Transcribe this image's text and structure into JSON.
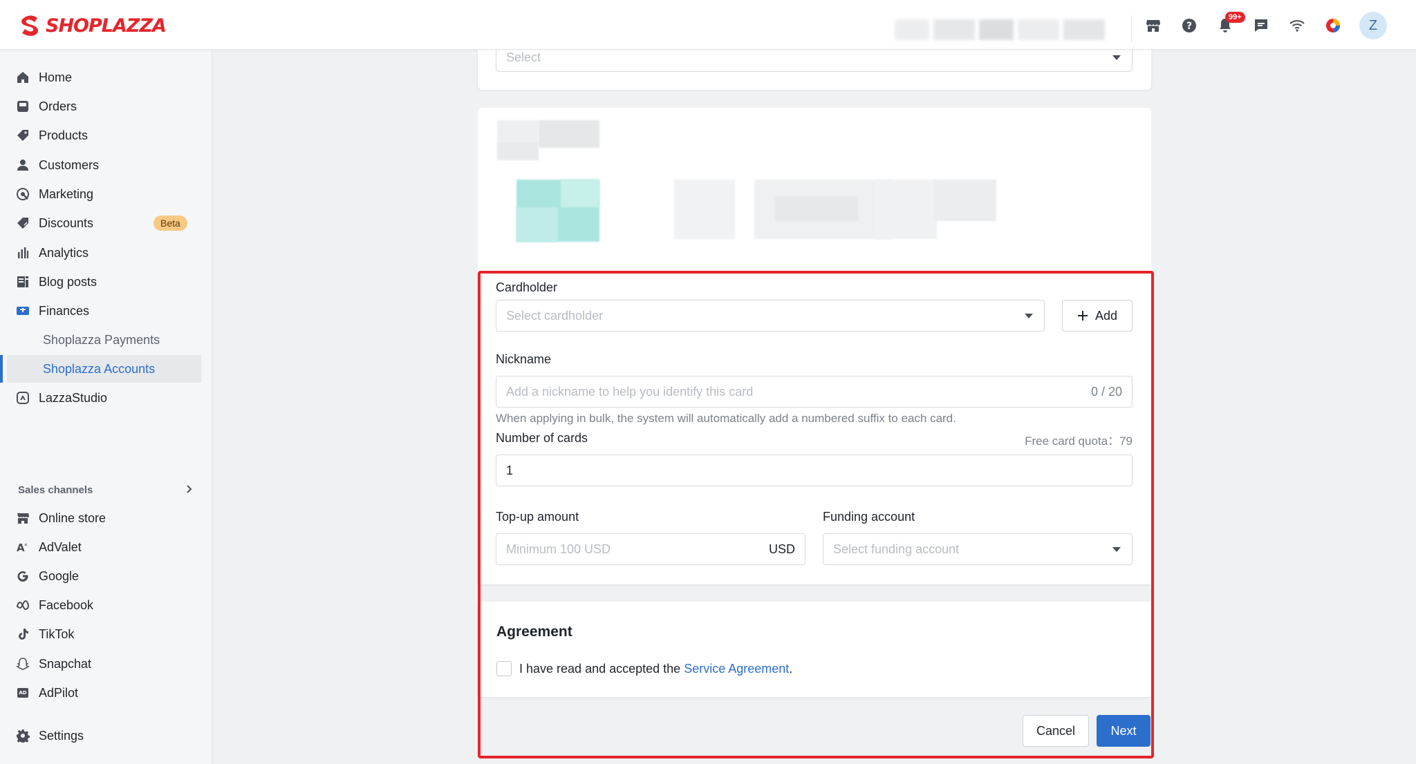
{
  "header": {
    "brand": "SHOPLAZZA",
    "notification_badge": "99+",
    "avatar_initial": "Z",
    "icons": [
      "store-icon",
      "help-icon",
      "bell-icon",
      "chat-icon",
      "wifi-icon",
      "browser-icon"
    ]
  },
  "sidebar": {
    "items": [
      {
        "label": "Home",
        "icon": "home-icon"
      },
      {
        "label": "Orders",
        "icon": "inbox-icon"
      },
      {
        "label": "Products",
        "icon": "tag-icon"
      },
      {
        "label": "Customers",
        "icon": "person-icon"
      },
      {
        "label": "Marketing",
        "icon": "target-icon"
      },
      {
        "label": "Discounts",
        "icon": "discount-icon",
        "badge": "Beta"
      },
      {
        "label": "Analytics",
        "icon": "bar-chart-icon"
      },
      {
        "label": "Blog posts",
        "icon": "document-icon"
      },
      {
        "label": "Finances",
        "icon": "finance-icon"
      }
    ],
    "finance_sub": [
      {
        "label": "Shoplazza Payments",
        "active": false
      },
      {
        "label": "Shoplazza Accounts",
        "active": true
      }
    ],
    "lazzastudio": "LazzaStudio",
    "sales_channels_title": "Sales channels",
    "channels": [
      {
        "label": "Online store",
        "icon": "store-icon"
      },
      {
        "label": "AdValet",
        "icon": "advalet-icon"
      },
      {
        "label": "Google",
        "icon": "google-icon"
      },
      {
        "label": "Facebook",
        "icon": "meta-icon"
      },
      {
        "label": "TikTok",
        "icon": "tiktok-icon"
      },
      {
        "label": "Snapchat",
        "icon": "snapchat-icon"
      },
      {
        "label": "AdPilot",
        "icon": "adpilot-icon"
      }
    ],
    "settings": "Settings"
  },
  "form": {
    "top_select_placeholder": "Select",
    "cardholder_label": "Cardholder",
    "cardholder_placeholder": "Select cardholder",
    "add_button": "Add",
    "nickname_label": "Nickname",
    "nickname_placeholder": "Add a nickname to help you identify this card",
    "nickname_counter": "0 / 20",
    "bulk_hint": "When applying in bulk, the system will automatically add a numbered suffix to each card.",
    "number_label": "Number of cards",
    "quota_label": "Free card quota：79",
    "number_value": "1",
    "topup_label": "Top-up amount",
    "topup_placeholder": "Minimum 100 USD",
    "topup_currency": "USD",
    "funding_label": "Funding account",
    "funding_placeholder": "Select funding account"
  },
  "agreement": {
    "title": "Agreement",
    "text_before": "I have read and accepted the ",
    "link": "Service Agreement",
    "text_after": "."
  },
  "footer": {
    "cancel": "Cancel",
    "next": "Next"
  },
  "colors": {
    "brand": "#e5262b",
    "primary": "#2c6ecb",
    "highlight": "#e5262b"
  }
}
